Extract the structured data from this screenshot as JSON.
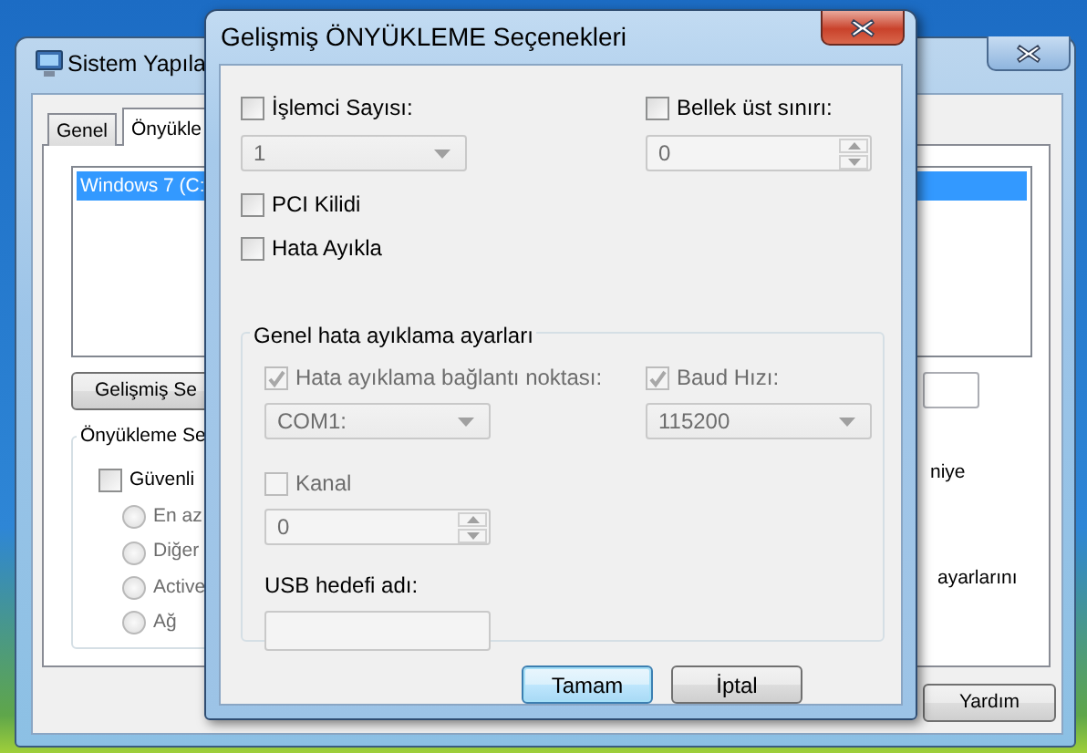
{
  "back_window": {
    "title": "Sistem Yapıla",
    "tabs": [
      {
        "label": "Genel",
        "selected": false
      },
      {
        "label": "Önyükle",
        "selected": true
      }
    ],
    "boot_list": [
      {
        "label": "Windows 7 (C:",
        "selected": true
      }
    ],
    "advanced_button": "Gelişmiş Se",
    "boot_group": {
      "title": "Önyükleme Se",
      "safe_boot": {
        "label": "Güvenli",
        "checked": false
      },
      "options": [
        {
          "label": "En az",
          "selected": false,
          "disabled": true
        },
        {
          "label": "Diğer",
          "selected": false,
          "disabled": true
        },
        {
          "label": "Active",
          "selected": false,
          "disabled": true
        },
        {
          "label": "Ağ",
          "selected": false,
          "disabled": true
        }
      ]
    },
    "side_texts": [
      "niye",
      "ayarlarını"
    ],
    "help_button": "Yardım"
  },
  "dialog": {
    "title": "Gelişmiş ÖNYÜKLEME Seçenekleri",
    "processors": {
      "label": "İşlemci Sayısı:",
      "checked": false,
      "value": "1",
      "disabled": true
    },
    "max_memory": {
      "label": "Bellek üst sınırı:",
      "checked": false,
      "value": "0",
      "disabled": true
    },
    "pci_lock": {
      "label": "PCI Kilidi",
      "checked": false
    },
    "debug": {
      "label": "Hata Ayıkla",
      "checked": false
    },
    "debug_settings": {
      "title": "Genel hata ayıklama ayarları",
      "port": {
        "label": "Hata ayıklama bağlantı noktası:",
        "checked": true,
        "disabled": true,
        "value": "COM1:"
      },
      "baud": {
        "label": "Baud Hızı:",
        "checked": true,
        "disabled": true,
        "value": "115200"
      },
      "channel": {
        "label": "Kanal",
        "checked": false,
        "disabled": true,
        "value": "0"
      },
      "usb_target": {
        "label": "USB hedefi adı:",
        "disabled": true
      }
    },
    "buttons": [
      {
        "label": "Tamam",
        "default": true
      },
      {
        "label": "İptal",
        "default": false
      }
    ]
  }
}
